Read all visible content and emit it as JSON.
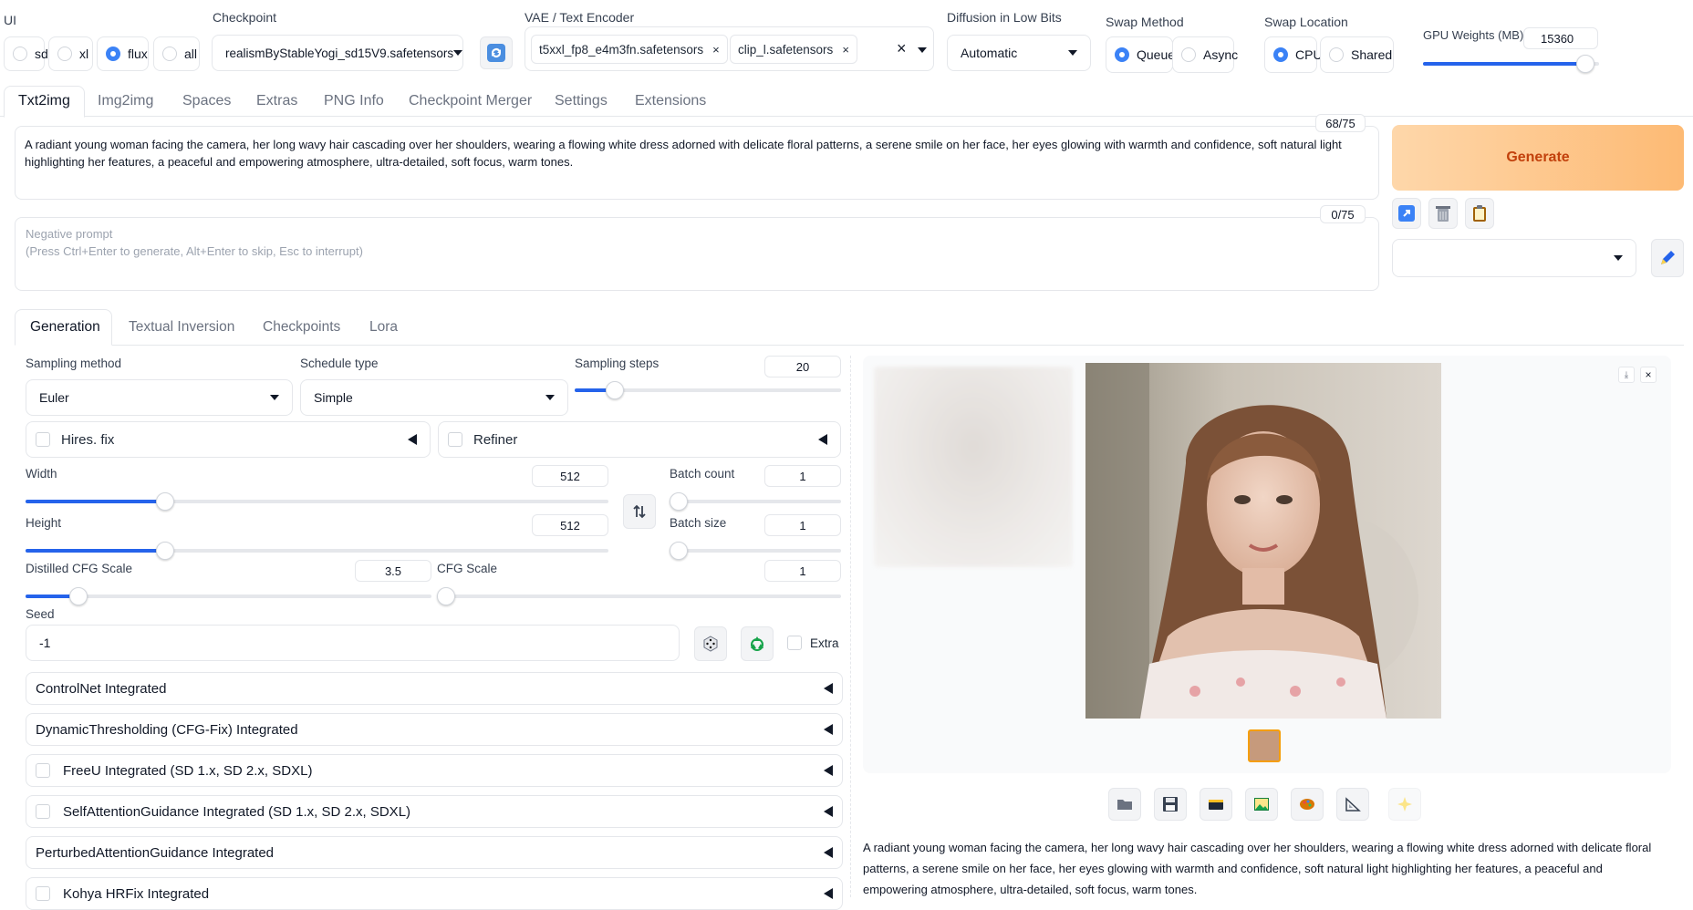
{
  "top": {
    "ui_label": "UI",
    "ui_options": [
      "sd",
      "xl",
      "flux",
      "all"
    ],
    "ui_selected": "flux",
    "checkpoint_label": "Checkpoint",
    "checkpoint_value": "realismByStableYogi_sd15V9.safetensors",
    "vae_label": "VAE / Text Encoder",
    "vae_chips": [
      "t5xxl_fp8_e4m3fn.safetensors",
      "clip_l.safetensors"
    ],
    "diffusion_label": "Diffusion in Low Bits",
    "diffusion_value": "Automatic",
    "swap_method_label": "Swap Method",
    "swap_method_options": [
      "Queue",
      "Async"
    ],
    "swap_method_selected": "Queue",
    "swap_location_label": "Swap Location",
    "swap_location_options": [
      "CPU",
      "Shared"
    ],
    "swap_location_selected": "CPU",
    "gpu_weights_label": "GPU Weights (MB)",
    "gpu_weights_value": "15360",
    "gpu_weights_fraction": 0.92
  },
  "tabs": [
    "Txt2img",
    "Img2img",
    "Spaces",
    "Extras",
    "PNG Info",
    "Checkpoint Merger",
    "Settings",
    "Extensions"
  ],
  "active_tab": "Txt2img",
  "prompt": {
    "text": "A radiant young woman facing the camera, her long wavy hair cascading over her shoulders, wearing a flowing white dress adorned with delicate floral patterns, a serene smile on her face, her eyes glowing with warmth and confidence, soft natural light highlighting her features, a peaceful and empowering atmosphere, ultra-detailed, soft focus, warm tones.",
    "token_count": "68/75",
    "negative_placeholder_line1": "Negative prompt",
    "negative_placeholder_line2": "(Press Ctrl+Enter to generate, Alt+Enter to skip, Esc to interrupt)",
    "negative_token_count": "0/75"
  },
  "generate_label": "Generate",
  "sub_tabs": [
    "Generation",
    "Textual Inversion",
    "Checkpoints",
    "Lora"
  ],
  "active_sub_tab": "Generation",
  "params": {
    "sampling_method_label": "Sampling method",
    "sampling_method_value": "Euler",
    "schedule_type_label": "Schedule type",
    "schedule_type_value": "Simple",
    "sampling_steps_label": "Sampling steps",
    "sampling_steps_value": "20",
    "sampling_steps_fraction": 0.15,
    "hires_label": "Hires. fix",
    "refiner_label": "Refiner",
    "width_label": "Width",
    "width_value": "512",
    "width_fraction": 0.24,
    "height_label": "Height",
    "height_value": "512",
    "height_fraction": 0.24,
    "batch_count_label": "Batch count",
    "batch_count_value": "1",
    "batch_count_fraction": 0.0,
    "batch_size_label": "Batch size",
    "batch_size_value": "1",
    "batch_size_fraction": 0.0,
    "distilled_cfg_label": "Distilled CFG Scale",
    "distilled_cfg_value": "3.5",
    "distilled_cfg_fraction": 0.13,
    "cfg_label": "CFG Scale",
    "cfg_value": "1",
    "cfg_fraction": 0.0,
    "seed_label": "Seed",
    "seed_value": "-1",
    "extra_label": "Extra"
  },
  "accordions": [
    {
      "label": "ControlNet Integrated",
      "checkbox": false
    },
    {
      "label": "DynamicThresholding (CFG-Fix) Integrated",
      "checkbox": false
    },
    {
      "label": "FreeU Integrated (SD 1.x, SD 2.x, SDXL)",
      "checkbox": true
    },
    {
      "label": "SelfAttentionGuidance Integrated (SD 1.x, SD 2.x, SDXL)",
      "checkbox": true
    },
    {
      "label": "PerturbedAttentionGuidance Integrated",
      "checkbox": false
    },
    {
      "label": "Kohya HRFix Integrated",
      "checkbox": true
    }
  ],
  "output": {
    "caption": "A radiant young woman facing the camera, her long wavy hair cascading over her shoulders, wearing a flowing white dress adorned with delicate floral patterns, a serene smile on her face, her eyes glowing with warmth and confidence, soft natural light highlighting her features, a peaceful and empowering atmosphere, ultra-detailed, soft focus, warm tones.",
    "tool_icons": [
      "folder-icon",
      "save-icon",
      "zip-icon",
      "send-to-img2img-icon",
      "send-to-inpaint-icon",
      "send-to-extras-icon",
      "sparkle-icon"
    ]
  },
  "colors": {
    "accent": "#2563eb",
    "generate_bg": "#fdba74",
    "generate_text": "#c2410c"
  }
}
